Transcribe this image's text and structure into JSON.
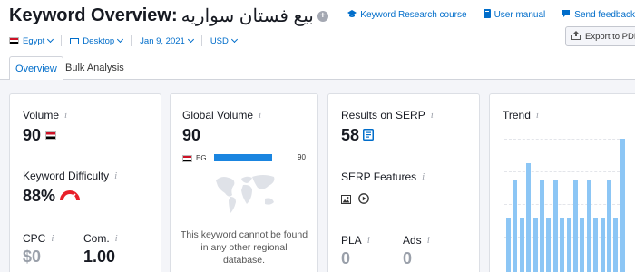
{
  "header": {
    "title": "Keyword Overview:",
    "keyword": "بيع فستان سواريه",
    "links": [
      {
        "label": "Keyword Research course",
        "icon": "graduation-cap-icon"
      },
      {
        "label": "User manual",
        "icon": "book-icon"
      },
      {
        "label": "Send feedback",
        "icon": "chat-bubble-icon"
      }
    ],
    "filters": {
      "country": "Egypt",
      "device": "Desktop",
      "date": "Jan 9, 2021",
      "currency": "USD"
    },
    "export_label": "Export to PDF"
  },
  "tabs": [
    {
      "label": "Overview",
      "active": true
    },
    {
      "label": "Bulk Analysis",
      "active": false
    }
  ],
  "cards": {
    "volume": {
      "label": "Volume",
      "value": "90"
    },
    "keyword_difficulty": {
      "label": "Keyword Difficulty",
      "value": "88%",
      "level": 0.88,
      "color": "#e8202a"
    },
    "cpc": {
      "label": "CPC",
      "value": "$0"
    },
    "com": {
      "label": "Com.",
      "value": "1.00"
    },
    "global_volume": {
      "label": "Global Volume",
      "value": "90",
      "countries": [
        {
          "code": "EG",
          "value": "90",
          "share": 1.0
        }
      ],
      "no_data_text": [
        "This keyword cannot be found",
        "in any other regional",
        "database."
      ]
    },
    "results_on_serp": {
      "label": "Results on SERP",
      "value": "58"
    },
    "serp_features": {
      "label": "SERP Features",
      "icons": [
        "image-icon",
        "video-play-icon"
      ]
    },
    "pla": {
      "label": "PLA",
      "value": "0"
    },
    "ads": {
      "label": "Ads",
      "value": "0"
    },
    "trend": {
      "label": "Trend",
      "values": [
        0.42,
        0.7,
        0.42,
        0.82,
        0.42,
        0.7,
        0.42,
        0.7,
        0.42,
        0.42,
        0.7,
        0.42,
        0.7,
        0.42,
        0.42,
        0.7,
        0.42,
        1.0
      ]
    }
  },
  "colors": {
    "accent": "#006dca",
    "bar_blue": "#1a85e0",
    "trend_bar": "#8cc6f5",
    "difficulty_red": "#e8202a"
  }
}
